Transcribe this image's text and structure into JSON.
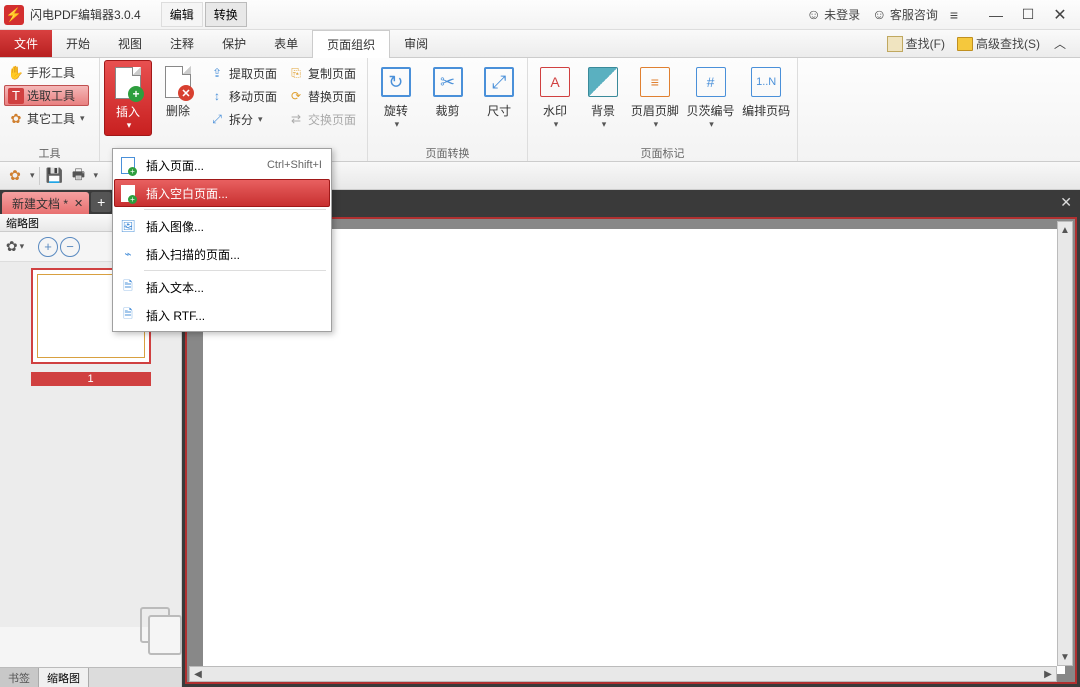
{
  "app": {
    "title": "闪电PDF编辑器3.0.4",
    "mode_edit": "编辑",
    "mode_convert": "转换",
    "not_logged": "未登录",
    "support": "客服咨询"
  },
  "menu": {
    "file": "文件",
    "start": "开始",
    "view": "视图",
    "annotate": "注释",
    "protect": "保护",
    "form": "表单",
    "pageorg": "页面组织",
    "review": "审阅",
    "find": "查找(F)",
    "adv_find": "高级查找(S)"
  },
  "ribbon": {
    "tools_label": "工具",
    "hand": "手形工具",
    "select": "选取工具",
    "other": "其它工具",
    "insert": "插入",
    "delete": "删除",
    "extract": "提取页面",
    "move": "移动页面",
    "split": "拆分",
    "copy": "复制页面",
    "replace": "替换页面",
    "swap": "交换页面",
    "rotate": "旋转",
    "crop": "裁剪",
    "size": "尺寸",
    "page_convert": "页面转换",
    "watermark": "水印",
    "background": "背景",
    "headerfooter": "页眉页脚",
    "bates": "贝茨编号",
    "numbering": "编排页码",
    "page_mark": "页面标记"
  },
  "dropdown": {
    "insert_page": "插入页面...",
    "insert_page_shortcut": "Ctrl+Shift+I",
    "insert_blank": "插入空白页面...",
    "insert_image": "插入图像...",
    "insert_scan": "插入扫描的页面...",
    "insert_text": "插入文本...",
    "insert_rtf": "插入 RTF..."
  },
  "doc": {
    "tab_name": "新建文档 *",
    "thumb_title": "缩略图",
    "page_num": "1",
    "tab_bookmark": "书签",
    "tab_thumb": "缩略图"
  }
}
